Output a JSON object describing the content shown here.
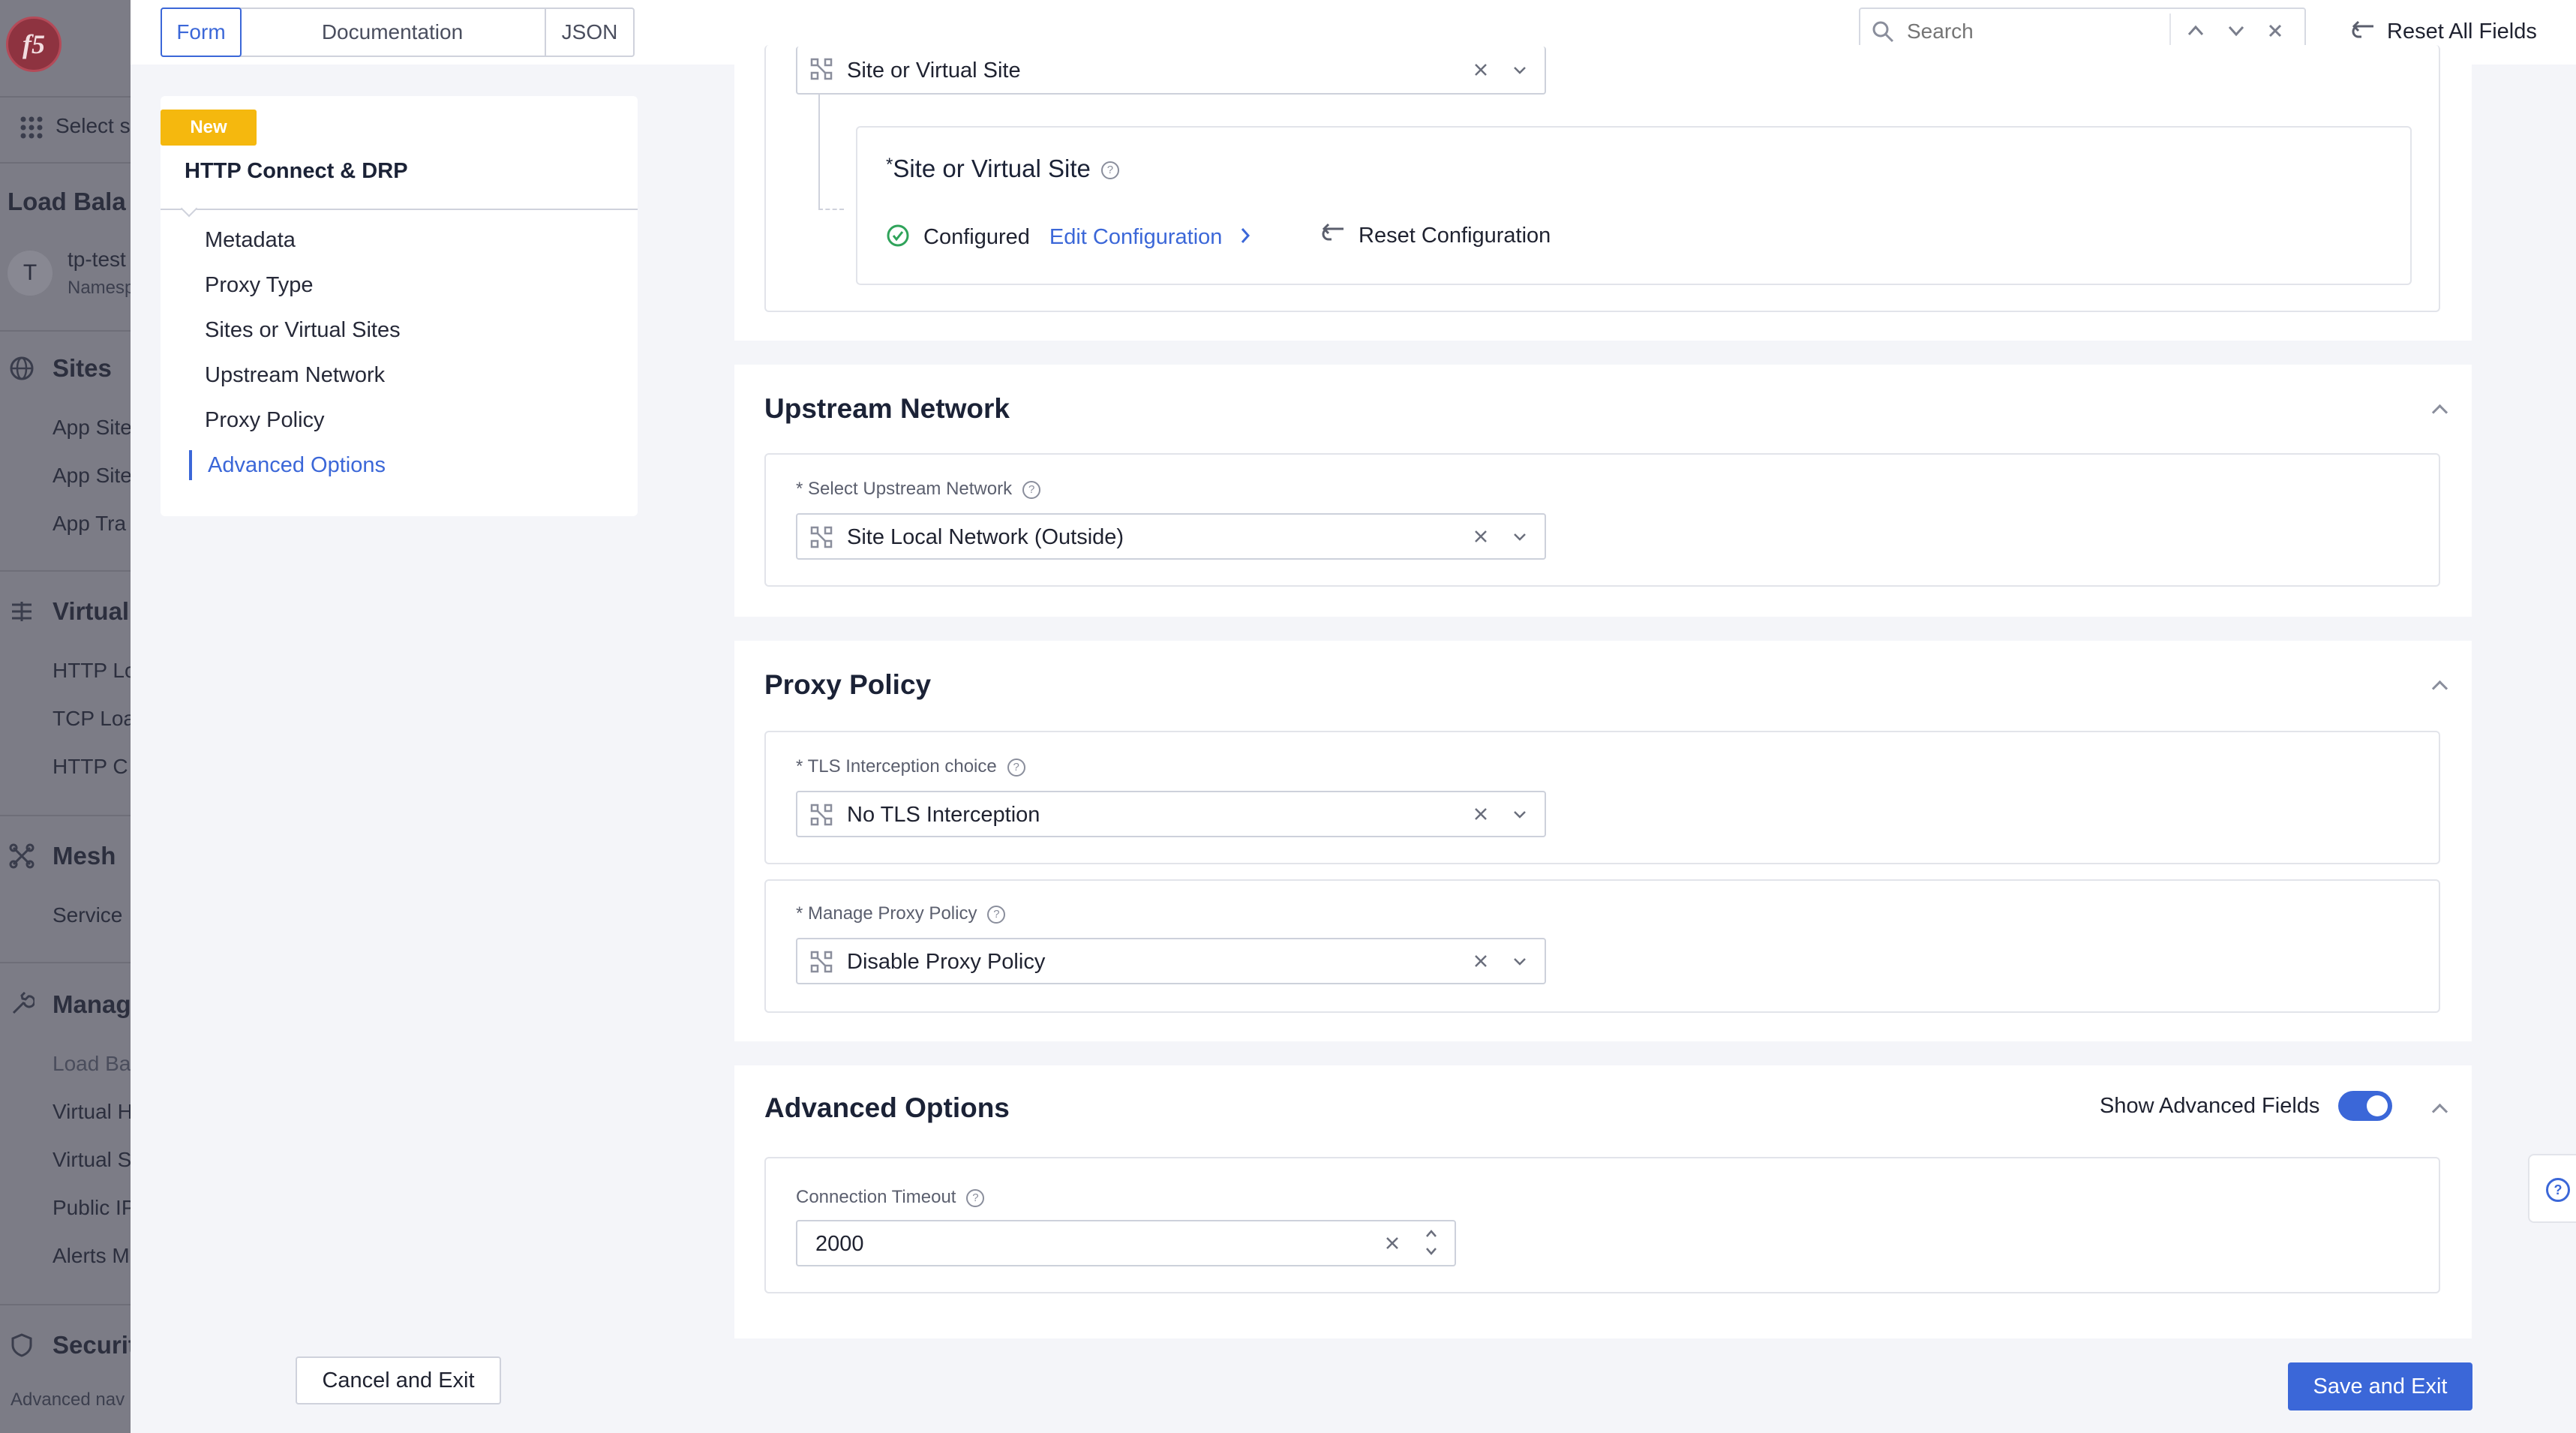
{
  "nav": {
    "select_label": "Select s",
    "page_title": "Load Bala",
    "namespace": {
      "avatar": "T",
      "name": "tp-test",
      "sub": "Namesp"
    },
    "groups": [
      {
        "heading": "Sites",
        "items": [
          "App Site",
          "App Site",
          "App Tra"
        ]
      },
      {
        "heading": "Virtual",
        "items": [
          "HTTP Lo",
          "TCP Loa",
          "HTTP C"
        ]
      },
      {
        "heading": "Mesh",
        "items": [
          "Service"
        ]
      },
      {
        "heading": "Manag",
        "items": [
          "Load Ba",
          "Virtual H",
          "Virtual S",
          "Public IP",
          "Alerts M"
        ]
      },
      {
        "heading": "Securit",
        "items": []
      }
    ],
    "footer": "Advanced nav"
  },
  "tabs": {
    "form": "Form",
    "documentation": "Documentation",
    "json": "JSON"
  },
  "search": {
    "placeholder": "Search"
  },
  "reset_all": "Reset All Fields",
  "progress": {
    "badge": "New",
    "title": "HTTP Connect & DRP",
    "items": [
      "Metadata",
      "Proxy Type",
      "Sites or Virtual Sites",
      "Upstream Network",
      "Proxy Policy",
      "Advanced Options"
    ],
    "active_index": 5
  },
  "site_section": {
    "select_value": "Site or Virtual Site",
    "inner_title": "Site or Virtual Site",
    "status": "Configured",
    "edit_link": "Edit Configuration",
    "reset_link": "Reset Configuration"
  },
  "upstream": {
    "title": "Upstream Network",
    "field_label": "Select Upstream Network",
    "value": "Site Local Network (Outside)"
  },
  "proxy_policy": {
    "title": "Proxy Policy",
    "tls_label": "TLS Interception choice",
    "tls_value": "No TLS Interception",
    "manage_label": "Manage Proxy Policy",
    "manage_value": "Disable Proxy Policy"
  },
  "advanced": {
    "title": "Advanced Options",
    "toggle_label": "Show Advanced Fields",
    "toggle_on": true,
    "timeout_label": "Connection Timeout",
    "timeout_value": "2000"
  },
  "footer": {
    "cancel": "Cancel and Exit",
    "save": "Save and Exit"
  },
  "colors": {
    "accent": "#3b67d8",
    "badge": "#f5b80e",
    "success": "#2fa35a",
    "nav_bg": "#7c7c86"
  }
}
